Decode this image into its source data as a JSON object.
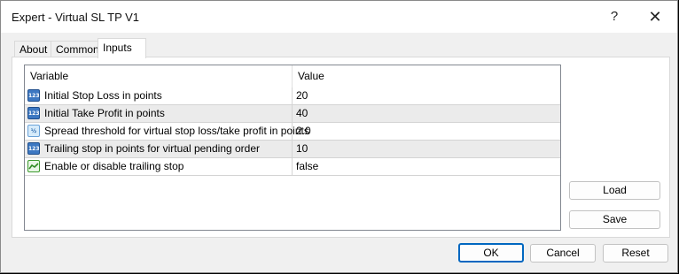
{
  "window": {
    "title": "Expert - Virtual SL TP V1",
    "help_label": "?",
    "close_label": "✕"
  },
  "tabs": [
    {
      "label": "About"
    },
    {
      "label": "Common"
    },
    {
      "label": "Inputs",
      "active": true
    }
  ],
  "table": {
    "headers": [
      "Variable",
      "Value"
    ],
    "rows": [
      {
        "icon": "integer-type-icon",
        "variable": "Initial Stop Loss in points",
        "value": "20"
      },
      {
        "icon": "integer-type-icon",
        "variable": "Initial Take Profit in points",
        "value": "40"
      },
      {
        "icon": "double-type-icon",
        "variable": "Spread threshold for virtual stop loss/take profit in points",
        "value": "2.0"
      },
      {
        "icon": "integer-type-icon",
        "variable": "Trailing stop in points for virtual pending order",
        "value": "10"
      },
      {
        "icon": "boolean-type-icon",
        "variable": "Enable or disable trailing stop",
        "value": "false"
      }
    ]
  },
  "side_buttons": {
    "load": "Load",
    "save": "Save"
  },
  "footer_buttons": {
    "ok": "OK",
    "cancel": "Cancel",
    "reset": "Reset"
  },
  "colors": {
    "ok_focus_border": "#0067c0",
    "alt_row": "#ebebeb"
  }
}
